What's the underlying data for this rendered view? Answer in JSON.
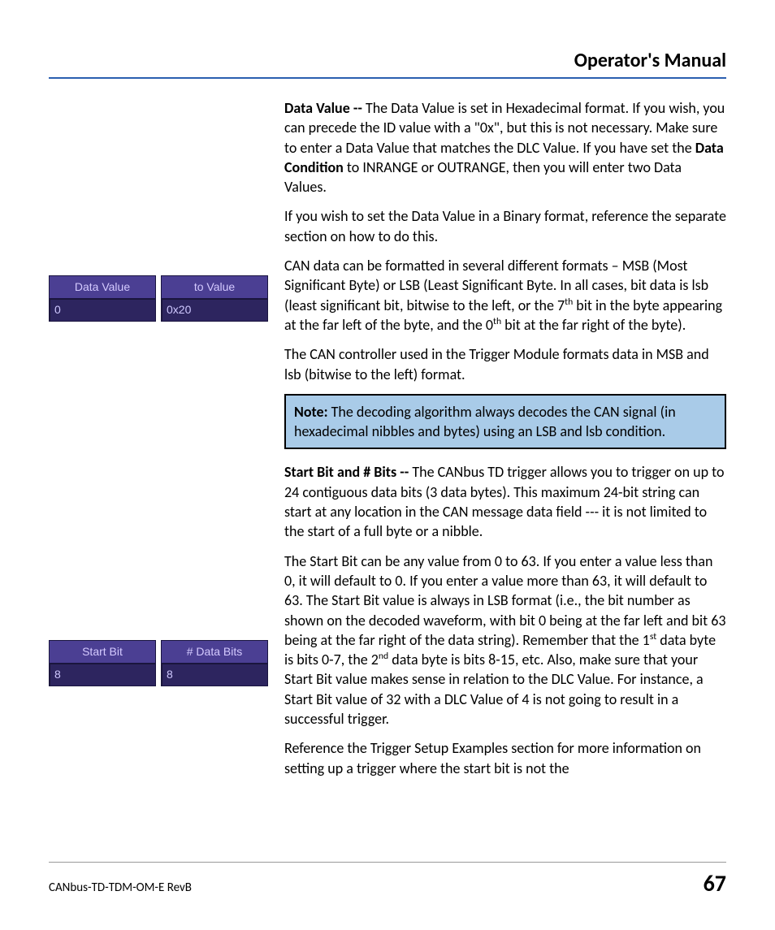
{
  "header": {
    "title": "Operator's Manual"
  },
  "widgets": {
    "dataValue": {
      "label": "Data Value",
      "value": "0"
    },
    "toValue": {
      "label": "to Value",
      "value": "0x20"
    },
    "startBit": {
      "label": "Start Bit",
      "value": "8"
    },
    "dataBits": {
      "label": "# Data Bits",
      "value": "8"
    }
  },
  "body": {
    "p1_lead": "Data Value -- ",
    "p1_mid1": "The Data Value is set in Hexadecimal format.  If you wish, you can precede the ID value with a \"0x\", but this is not necessary.  Make sure to enter a Data Value that matches the DLC Value.  If you have set the ",
    "p1_bold": "Data Condition",
    "p1_tail": " to INRANGE or OUTRANGE, then you will enter two Data Values.",
    "p2": "If you wish to set the Data Value in a Binary format, reference the separate section on how to do this.",
    "p3_a": "CAN data can be formatted in several different formats – MSB (Most Significant Byte) or LSB (Least Significant Byte.  In all cases, bit data is lsb (least significant bit, bitwise to the left, or the 7",
    "p3_sup1": "th",
    "p3_b": " bit in the byte appearing at the far left of the byte, and the 0",
    "p3_sup2": "th",
    "p3_c": " bit at the far right of the byte).",
    "p4": "The CAN controller used in the Trigger Module formats data in MSB and lsb (bitwise to the left) format.",
    "note_lead": "Note:",
    "note_body": " The decoding algorithm always decodes the CAN signal (in hexadecimal nibbles and bytes) using an LSB and lsb condition.",
    "p5_lead": "Start Bit and # Bits -- ",
    "p5_body": "The CANbus TD trigger allows you to trigger on up to 24 contiguous data bits (3 data bytes).  This maximum 24-bit string can start at any location in the CAN message data field --- it is not limited to the start of a full byte or a nibble.",
    "p6_a": "The Start Bit can be any value from 0 to 63.  If you enter a value less than 0, it will default to 0.  If you enter a value more than 63, it will default to 63.  The Start Bit value is always in LSB format (i.e., the bit number as shown on the decoded waveform, with bit 0 being at the far left and bit 63 being at the far right of the data string).  Remember that the 1",
    "p6_sup1": "st",
    "p6_b": " data byte is bits 0-7, the 2",
    "p6_sup2": "nd",
    "p6_c": " data byte is bits 8-15, etc.  Also, make sure that your Start Bit value makes sense in relation to the DLC Value.  For instance, a Start Bit value of 32 with a DLC Value of 4 is not going to result in a successful trigger.",
    "p7": "Reference the Trigger Setup Examples section for more information on setting up a trigger where the start bit is not the"
  },
  "footer": {
    "doc": "CANbus-TD-TDM-OM-E RevB",
    "page": "67"
  }
}
